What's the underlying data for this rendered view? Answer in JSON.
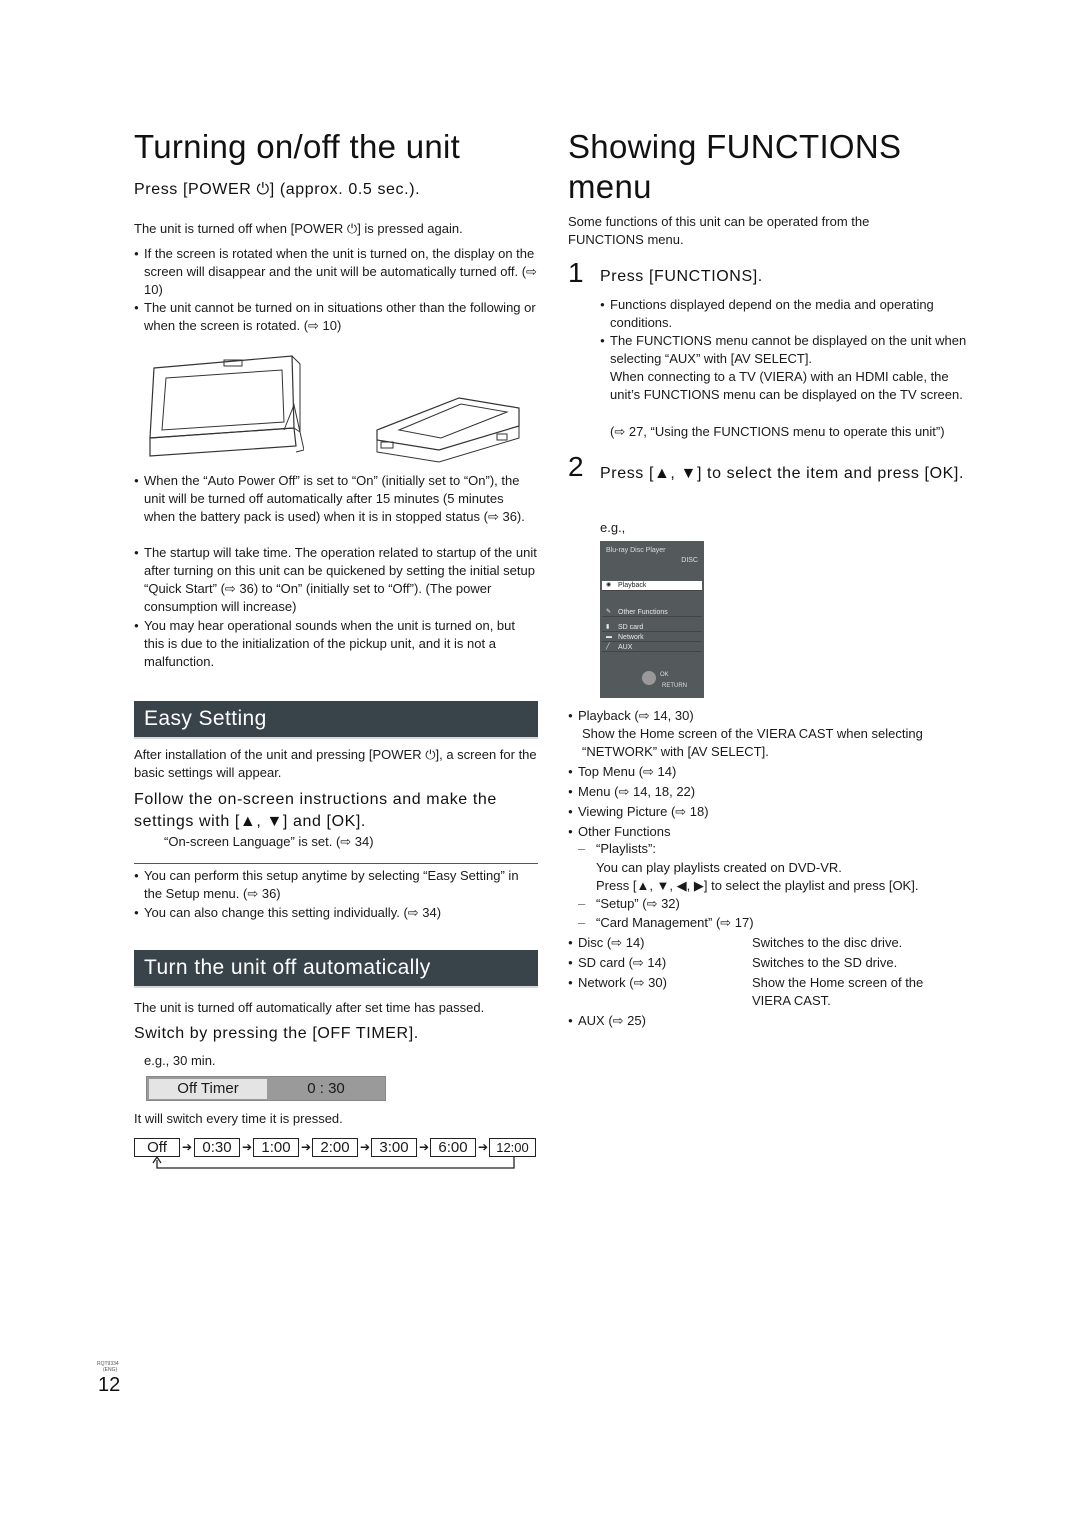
{
  "left": {
    "title": "Turning on/off the unit",
    "instruction": "Press [POWER ⏻] (approx. 0.5 sec.).",
    "intro": "The unit is turned off when [POWER ⏻] is pressed again.",
    "bullets_top": [
      "If the screen is rotated when the unit is turned on, the display on the screen will disappear and the unit will be automatically turned off. (⇨ 10)",
      "The unit cannot be turned on in situations other than the following or when the screen is rotated. (⇨ 10)"
    ],
    "bullets_bottom": [
      "When the “Auto Power Off” is set to “On” (initially set to “On”), the unit will be turned off automatically after 15 minutes (5 minutes when the battery pack is used) when it is in stopped status (⇨ 36).",
      "The startup will take time. The operation related to startup of the unit after turning on this unit can be quickened by setting the initial setup “Quick Start” (⇨ 36) to “On” (initially set to “Off”). (The power consumption will increase)",
      "You may hear operational sounds when the unit is turned on, but this is due to the initialization of the pickup unit, and it is not a malfunction."
    ],
    "easy_setting": {
      "heading": "Easy Setting",
      "intro": "After installation of the unit and pressing [POWER ⏻], a screen for the basic settings will appear.",
      "instruction": "Follow the on-screen instructions and make the settings with [▲, ▼] and [OK].",
      "note": "“On-screen Language” is set. (⇨ 34)",
      "bullets": [
        "You can perform this setup anytime by selecting “Easy Setting” in the Setup menu. (⇨ 36)",
        "You can also change this setting individually. (⇨ 34)"
      ]
    },
    "auto_off": {
      "heading": "Turn the unit off automatically",
      "intro": "The unit is turned off automatically after set time has passed.",
      "instruction": "Switch by pressing the [OFF TIMER].",
      "example": "e.g., 30 min.",
      "timer_label": "Off Timer",
      "timer_value": "0 : 30",
      "note": "It will switch every time it is pressed.",
      "sequence": [
        "Off",
        "0:30",
        "1:00",
        "2:00",
        "3:00",
        "6:00",
        "12:00"
      ]
    }
  },
  "right": {
    "title_line1": "Showing FUNCTIONS",
    "title_line2": "menu",
    "intro": "Some functions of this unit can be operated from the FUNCTIONS menu.",
    "step1": {
      "num": "1",
      "text": "Press [FUNCTIONS].",
      "bullets": [
        "Functions displayed depend on the media and operating conditions.",
        "The FUNCTIONS menu cannot be displayed on the unit when selecting “AUX” with [AV SELECT]."
      ],
      "extra": "When connecting to a TV (VIERA) with an HDMI cable, the unit’s FUNCTIONS menu can be displayed on the TV screen.",
      "ref": "(⇨ 27, “Using the FUNCTIONS menu to operate this unit”)"
    },
    "step2": {
      "num": "2",
      "text": "Press [▲, ▼] to select the item and press [OK].",
      "example": "e.g.,"
    },
    "screen": {
      "title": "Blu-ray Disc Player",
      "media": "DISC",
      "items": [
        "Playback",
        "Other Functions",
        "SD card",
        "Network",
        "AUX"
      ],
      "selected": "Playback",
      "ok": "OK",
      "return": "RETURN"
    },
    "items": [
      {
        "label": "Playback (⇨ 14, 30)",
        "desc": "Show the Home screen of the VIERA CAST when selecting “NETWORK” with [AV SELECT]."
      },
      {
        "label": "Top Menu (⇨ 14)"
      },
      {
        "label": "Menu (⇨ 14, 18, 22)"
      },
      {
        "label": "Viewing Picture (⇨ 18)"
      },
      {
        "label": "Other Functions"
      }
    ],
    "sub_items": [
      {
        "label": "“Playlists”:",
        "desc1": "You can play playlists created on DVD-VR.",
        "desc2": "Press [▲, ▼, ◀, ▶] to select the playlist and press [OK]."
      },
      {
        "label": "“Setup” (⇨ 32)"
      },
      {
        "label": "“Card Management” (⇨ 17)"
      }
    ],
    "table": [
      {
        "label": "Disc (⇨ 14)",
        "desc": "Switches to the disc drive."
      },
      {
        "label": "SD card (⇨ 14)",
        "desc": "Switches to the SD drive."
      },
      {
        "label": "Network (⇨ 30)",
        "desc": "Show the Home screen of the",
        "desc2": "VIERA CAST."
      },
      {
        "label": "AUX (⇨ 25)",
        "desc": ""
      }
    ]
  },
  "footer": {
    "code": "RQT9334",
    "lang": "(ENG)",
    "page_number": "12"
  }
}
